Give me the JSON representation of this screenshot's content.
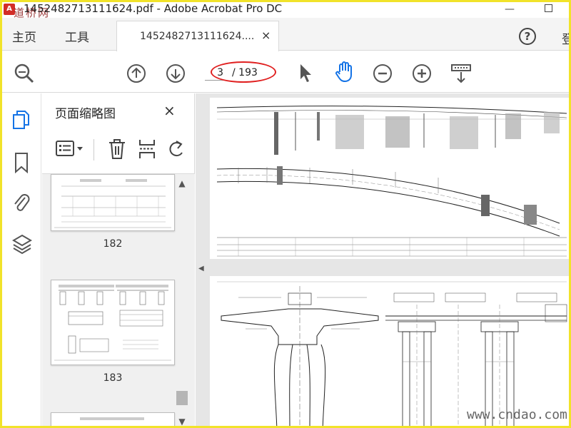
{
  "window": {
    "title": "1452482713111624.pdf - Adobe Acrobat Pro DC",
    "watermark_top": "道桥网"
  },
  "tabbar": {
    "home_label": "主页",
    "tools_label": "工具",
    "doc_tab_label": "1452482713111624....",
    "doc_tab_close": "×",
    "help_label": "?",
    "login_label": "登"
  },
  "toolbar": {
    "icons": [
      "zoom-search-icon",
      "page-up-icon",
      "page-down-icon",
      "select-arrow-icon",
      "hand-tool-icon",
      "zoom-out-icon",
      "zoom-in-icon",
      "page-fit-icon"
    ],
    "current_page": "3",
    "page_total": "/ 193",
    "highlight_color": "#e02020"
  },
  "left_rail": {
    "icons": [
      "page-thumbnails-icon",
      "bookmark-icon",
      "attachment-icon",
      "layers-icon"
    ],
    "active_color": "#1473e6"
  },
  "thumbnail_panel": {
    "title": "页面缩略图",
    "close": "×",
    "tools": [
      "thumbnail-options-icon",
      "delete-icon",
      "extract-icon",
      "rotate-icon"
    ],
    "thumbnails": [
      {
        "label": "182"
      },
      {
        "label": "183"
      },
      {
        "label": ""
      }
    ]
  },
  "document": {
    "watermark_bottom": "www.cndao.com"
  }
}
